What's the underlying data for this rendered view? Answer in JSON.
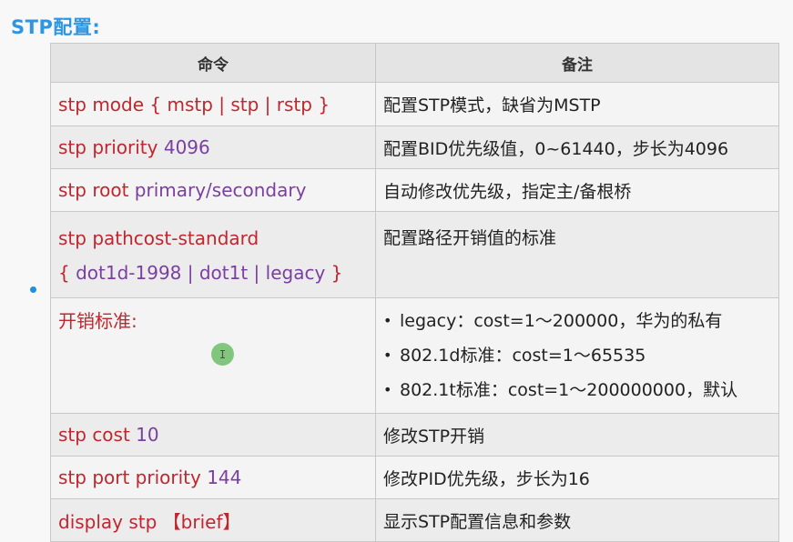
{
  "title": "STP配置:",
  "table": {
    "headers": [
      "命令",
      "备注"
    ],
    "rows": [
      {
        "cmd_keyword": "stp mode ",
        "cmd_args": "{ mstp | stp | rstp }",
        "note": "配置STP模式，缺省为MSTP"
      },
      {
        "cmd_keyword": "stp priority ",
        "cmd_args": "4096",
        "note": "配置BID优先级值，0~61440，步长为4096"
      },
      {
        "cmd_keyword": "stp root ",
        "cmd_args": "primary/secondary",
        "note": "自动修改优先级，指定主/备根桥"
      },
      {
        "cmd_keyword": "stp pathcost-standard",
        "cmd_line2_open": "{ ",
        "cmd_line2_args": "dot1d-1998  | dot1t  |  legacy",
        "cmd_line2_close": " }",
        "note": "配置路径开销值的标准"
      },
      {
        "cmd_keyword": "开销标准:",
        "notes": [
          "legacy：cost=1～200000，华为的私有",
          "802.1d标准：cost=1～65535",
          "802.1t标准：cost=1～200000000，默认"
        ]
      },
      {
        "cmd_keyword": "stp cost ",
        "cmd_args": "10",
        "note": "修改STP开销"
      },
      {
        "cmd_keyword": "stp port priority ",
        "cmd_args": "144",
        "note": "修改PID优先级，步长为16"
      },
      {
        "cmd_keyword": "display stp ",
        "cmd_args": "【brief】",
        "note": "显示STP配置信息和参数"
      }
    ]
  },
  "cursor_glyph": "I"
}
